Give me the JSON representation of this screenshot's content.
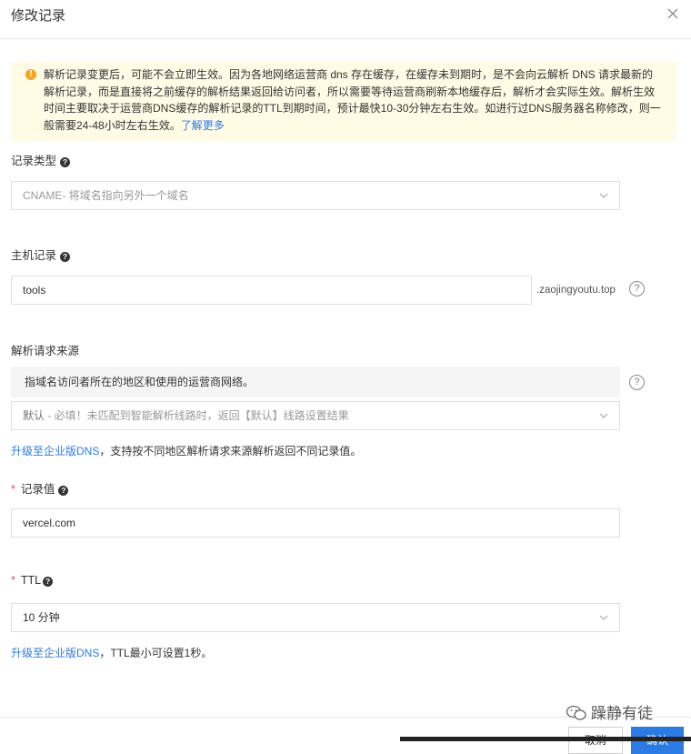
{
  "dialog": {
    "title": "修改记录"
  },
  "notice": {
    "text": "解析记录变更后，可能不会立即生效。因为各地网络运营商 dns 存在缓存，在缓存未到期时，是不会向云解析 DNS 请求最新的解析记录，而是直接将之前缓存的解析结果返回给访问者，所以需要等待运营商刷新本地缓存后，解析才会实际生效。解析生效时间主要取决于运营商DNS缓存的解析记录的TTL到期时间，预计最快10-30分钟左右生效。如进行过DNS服务器名称修改，则一般需要24-48小时左右生效。",
    "link": "了解更多"
  },
  "record_type": {
    "label": "记录类型",
    "value": "CNAME- 将域名指向另外一个域名"
  },
  "host": {
    "label": "主机记录",
    "value": "tools",
    "suffix": ".zaojingyoutu.top"
  },
  "source": {
    "label": "解析请求来源",
    "info": "指域名访问者所在的地区和使用的运营商网络。",
    "value_main": "默认",
    "value_hint": " - 必填！未匹配到智能解析线路时，返回【默认】线路设置结果",
    "tip_link": "升级至企业版DNS",
    "tip_text": "，支持按不同地区解析请求来源解析返回不同记录值。"
  },
  "record_value": {
    "label": "记录值",
    "value": "vercel.com"
  },
  "ttl": {
    "label": "TTL",
    "value": "10 分钟",
    "tip_link": "升级至企业版DNS",
    "tip_text": "，TTL最小可设置1秒。"
  },
  "footer": {
    "cancel": "取消",
    "ok": "确认"
  },
  "watermark": "躁静有徒",
  "colors": {
    "accent": "#2c7be5",
    "warning": "#f5a623",
    "notice_bg": "#fffbe5",
    "required": "#e34d59"
  }
}
